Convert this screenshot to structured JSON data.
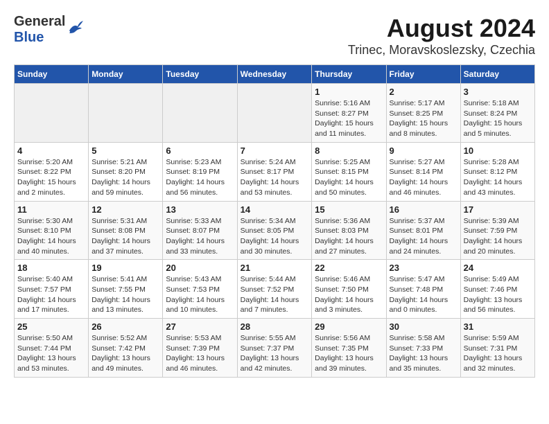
{
  "header": {
    "logo_line1": "General",
    "logo_line2": "Blue",
    "title": "August 2024",
    "subtitle": "Trinec, Moravskoslezsky, Czechia"
  },
  "calendar": {
    "days_of_week": [
      "Sunday",
      "Monday",
      "Tuesday",
      "Wednesday",
      "Thursday",
      "Friday",
      "Saturday"
    ],
    "weeks": [
      [
        {
          "day": "",
          "info": ""
        },
        {
          "day": "",
          "info": ""
        },
        {
          "day": "",
          "info": ""
        },
        {
          "day": "",
          "info": ""
        },
        {
          "day": "1",
          "info": "Sunrise: 5:16 AM\nSunset: 8:27 PM\nDaylight: 15 hours\nand 11 minutes."
        },
        {
          "day": "2",
          "info": "Sunrise: 5:17 AM\nSunset: 8:25 PM\nDaylight: 15 hours\nand 8 minutes."
        },
        {
          "day": "3",
          "info": "Sunrise: 5:18 AM\nSunset: 8:24 PM\nDaylight: 15 hours\nand 5 minutes."
        }
      ],
      [
        {
          "day": "4",
          "info": "Sunrise: 5:20 AM\nSunset: 8:22 PM\nDaylight: 15 hours\nand 2 minutes."
        },
        {
          "day": "5",
          "info": "Sunrise: 5:21 AM\nSunset: 8:20 PM\nDaylight: 14 hours\nand 59 minutes."
        },
        {
          "day": "6",
          "info": "Sunrise: 5:23 AM\nSunset: 8:19 PM\nDaylight: 14 hours\nand 56 minutes."
        },
        {
          "day": "7",
          "info": "Sunrise: 5:24 AM\nSunset: 8:17 PM\nDaylight: 14 hours\nand 53 minutes."
        },
        {
          "day": "8",
          "info": "Sunrise: 5:25 AM\nSunset: 8:15 PM\nDaylight: 14 hours\nand 50 minutes."
        },
        {
          "day": "9",
          "info": "Sunrise: 5:27 AM\nSunset: 8:14 PM\nDaylight: 14 hours\nand 46 minutes."
        },
        {
          "day": "10",
          "info": "Sunrise: 5:28 AM\nSunset: 8:12 PM\nDaylight: 14 hours\nand 43 minutes."
        }
      ],
      [
        {
          "day": "11",
          "info": "Sunrise: 5:30 AM\nSunset: 8:10 PM\nDaylight: 14 hours\nand 40 minutes."
        },
        {
          "day": "12",
          "info": "Sunrise: 5:31 AM\nSunset: 8:08 PM\nDaylight: 14 hours\nand 37 minutes."
        },
        {
          "day": "13",
          "info": "Sunrise: 5:33 AM\nSunset: 8:07 PM\nDaylight: 14 hours\nand 33 minutes."
        },
        {
          "day": "14",
          "info": "Sunrise: 5:34 AM\nSunset: 8:05 PM\nDaylight: 14 hours\nand 30 minutes."
        },
        {
          "day": "15",
          "info": "Sunrise: 5:36 AM\nSunset: 8:03 PM\nDaylight: 14 hours\nand 27 minutes."
        },
        {
          "day": "16",
          "info": "Sunrise: 5:37 AM\nSunset: 8:01 PM\nDaylight: 14 hours\nand 24 minutes."
        },
        {
          "day": "17",
          "info": "Sunrise: 5:39 AM\nSunset: 7:59 PM\nDaylight: 14 hours\nand 20 minutes."
        }
      ],
      [
        {
          "day": "18",
          "info": "Sunrise: 5:40 AM\nSunset: 7:57 PM\nDaylight: 14 hours\nand 17 minutes."
        },
        {
          "day": "19",
          "info": "Sunrise: 5:41 AM\nSunset: 7:55 PM\nDaylight: 14 hours\nand 13 minutes."
        },
        {
          "day": "20",
          "info": "Sunrise: 5:43 AM\nSunset: 7:53 PM\nDaylight: 14 hours\nand 10 minutes."
        },
        {
          "day": "21",
          "info": "Sunrise: 5:44 AM\nSunset: 7:52 PM\nDaylight: 14 hours\nand 7 minutes."
        },
        {
          "day": "22",
          "info": "Sunrise: 5:46 AM\nSunset: 7:50 PM\nDaylight: 14 hours\nand 3 minutes."
        },
        {
          "day": "23",
          "info": "Sunrise: 5:47 AM\nSunset: 7:48 PM\nDaylight: 14 hours\nand 0 minutes."
        },
        {
          "day": "24",
          "info": "Sunrise: 5:49 AM\nSunset: 7:46 PM\nDaylight: 13 hours\nand 56 minutes."
        }
      ],
      [
        {
          "day": "25",
          "info": "Sunrise: 5:50 AM\nSunset: 7:44 PM\nDaylight: 13 hours\nand 53 minutes."
        },
        {
          "day": "26",
          "info": "Sunrise: 5:52 AM\nSunset: 7:42 PM\nDaylight: 13 hours\nand 49 minutes."
        },
        {
          "day": "27",
          "info": "Sunrise: 5:53 AM\nSunset: 7:39 PM\nDaylight: 13 hours\nand 46 minutes."
        },
        {
          "day": "28",
          "info": "Sunrise: 5:55 AM\nSunset: 7:37 PM\nDaylight: 13 hours\nand 42 minutes."
        },
        {
          "day": "29",
          "info": "Sunrise: 5:56 AM\nSunset: 7:35 PM\nDaylight: 13 hours\nand 39 minutes."
        },
        {
          "day": "30",
          "info": "Sunrise: 5:58 AM\nSunset: 7:33 PM\nDaylight: 13 hours\nand 35 minutes."
        },
        {
          "day": "31",
          "info": "Sunrise: 5:59 AM\nSunset: 7:31 PM\nDaylight: 13 hours\nand 32 minutes."
        }
      ]
    ]
  }
}
